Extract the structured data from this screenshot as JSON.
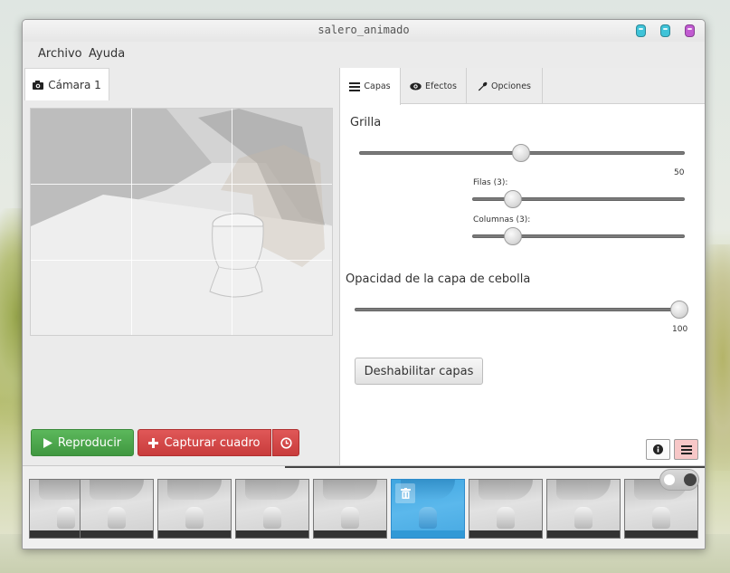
{
  "window": {
    "title": "salero_animado",
    "buttons": [
      {
        "name": "minimize",
        "color": "#3fc3d8"
      },
      {
        "name": "maximize",
        "color": "#3fc3d8"
      },
      {
        "name": "close",
        "color": "#c15bd1"
      }
    ]
  },
  "menu": {
    "items": [
      "Archivo",
      "Ayuda"
    ]
  },
  "camera_tab": {
    "label": "Cámara 1",
    "icon": "camera-icon"
  },
  "buttons": {
    "play": {
      "label": "Reproducir",
      "icon": "play-icon",
      "color": "#4cae4c"
    },
    "capture": {
      "label": "Capturar cuadro",
      "icon": "plus-icon",
      "color": "#d9534f"
    },
    "timer": {
      "icon": "clock-icon"
    }
  },
  "right_tabs": [
    {
      "label": "Capas",
      "icon": "list-icon",
      "active": true
    },
    {
      "label": "Efectos",
      "icon": "eye-icon",
      "active": false
    },
    {
      "label": "Opciones",
      "icon": "wrench-icon",
      "active": false
    }
  ],
  "grid": {
    "title": "Grilla",
    "value": "50",
    "value_fraction": 0.5,
    "rows_label": "Filas (3):",
    "rows_fraction": 0.14,
    "cols_label": "Columnas (3):",
    "cols_fraction": 0.14
  },
  "onion": {
    "title": "Opacidad de la capa de cebolla",
    "value": "100",
    "value_fraction": 1.0
  },
  "disable_layers_label": "Deshabilitar capas",
  "bottom_icons": [
    "info-icon",
    "layers-icon"
  ],
  "timeline": {
    "frame_count": 9,
    "selected_index": 5,
    "selected_icon": "trash-icon",
    "toggle": "off"
  }
}
